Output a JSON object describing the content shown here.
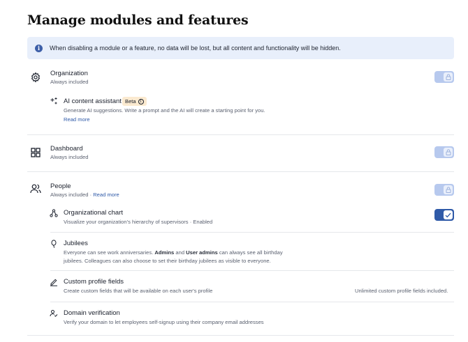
{
  "page": {
    "title": "Manage modules and features"
  },
  "banner": {
    "text": "When disabling a module or a feature, no data will be lost, but all content and functionality will be hidden."
  },
  "organization": {
    "title": "Organization",
    "subtitle": "Always included",
    "ai": {
      "title": "AI content assistant",
      "badge": "Beta",
      "desc": "Generate AI suggestions. Write a prompt and the AI will create a starting point for you.",
      "link": "Read more"
    }
  },
  "dashboard": {
    "title": "Dashboard",
    "subtitle": "Always included"
  },
  "people": {
    "title": "People",
    "subtitle": "Always included",
    "sep": " · ",
    "link": "Read more",
    "features": {
      "org_chart": {
        "title": "Organizational chart",
        "desc": "Visualize your organization's hierarchy of supervisors · Enabled"
      },
      "jubilees": {
        "title": "Jubilees",
        "desc_1": "Everyone can see work anniversaries. ",
        "desc_b1": "Admins",
        "desc_2": " and ",
        "desc_b2": "User admins",
        "desc_3": " can always see all birthday",
        "desc_4": "jubilees. Colleagues can also choose to set their birthday jubilees as visible to everyone."
      },
      "custom_fields": {
        "title": "Custom profile fields",
        "desc": "Create custom fields that will be available on each user's profile",
        "note": "Unlimited custom profile fields included."
      },
      "domain": {
        "title": "Domain verification",
        "desc": "Verify your domain to let employees self-signup using their company email addresses"
      }
    }
  }
}
